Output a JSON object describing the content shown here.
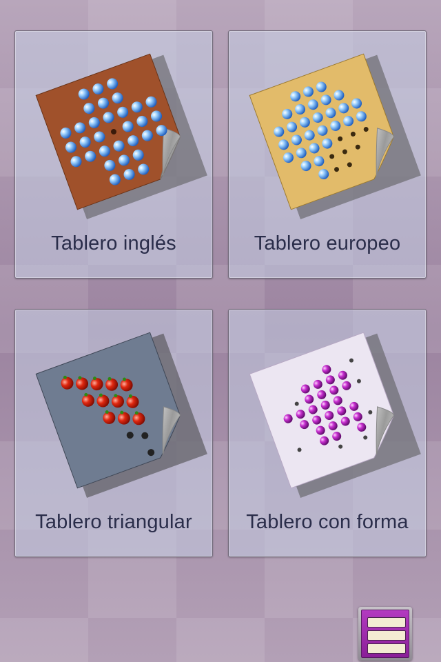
{
  "boards": [
    {
      "label": "Tablero inglés",
      "board_color": "#a0512b",
      "peg": "blue-marble"
    },
    {
      "label": "Tablero europeo",
      "board_color": "#e2bb6a",
      "peg": "blue-marble"
    },
    {
      "label": "Tablero triangular",
      "board_color": "#6f7c91",
      "peg": "red-apple"
    },
    {
      "label": "Tablero con forma",
      "board_color": "#ece6f2",
      "peg": "purple-bead"
    }
  ],
  "menu": {
    "icon": "menu-icon"
  }
}
